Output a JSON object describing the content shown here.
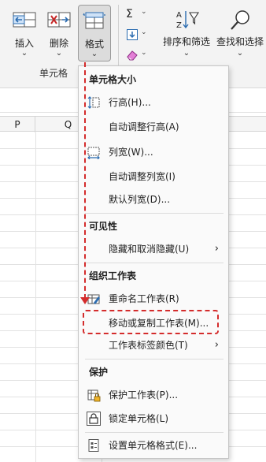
{
  "ribbon": {
    "insert_label": "插入",
    "delete_label": "删除",
    "format_label": "格式",
    "group_label": "单元格",
    "sort_filter_label": "排序和筛选",
    "find_select_label": "查找和选择",
    "autosum_symbol": "Σ",
    "dropdown_chevron": "⌄"
  },
  "sheet": {
    "columns": [
      "P",
      "Q"
    ]
  },
  "menu": {
    "section_cell_size": "单元格大小",
    "row_height": "行高(H)...",
    "autofit_row_height": "自动调整行高(A)",
    "column_width": "列宽(W)...",
    "autofit_column_width": "自动调整列宽(I)",
    "default_width": "默认列宽(D)...",
    "section_visibility": "可见性",
    "hide_unhide": "隐藏和取消隐藏(U)",
    "section_organize": "组织工作表",
    "rename_sheet": "重命名工作表(R)",
    "move_copy_sheet": "移动或复制工作表(M)...",
    "tab_color": "工作表标签颜色(T)",
    "section_protection": "保护",
    "protect_sheet": "保护工作表(P)...",
    "lock_cell": "锁定单元格(L)",
    "format_cells": "设置单元格格式(E)...",
    "submenu_arrow": "›"
  },
  "colors": {
    "annotation_red": "#d42c2c",
    "icon_blue": "#2b6cb0",
    "icon_red": "#c62828"
  }
}
